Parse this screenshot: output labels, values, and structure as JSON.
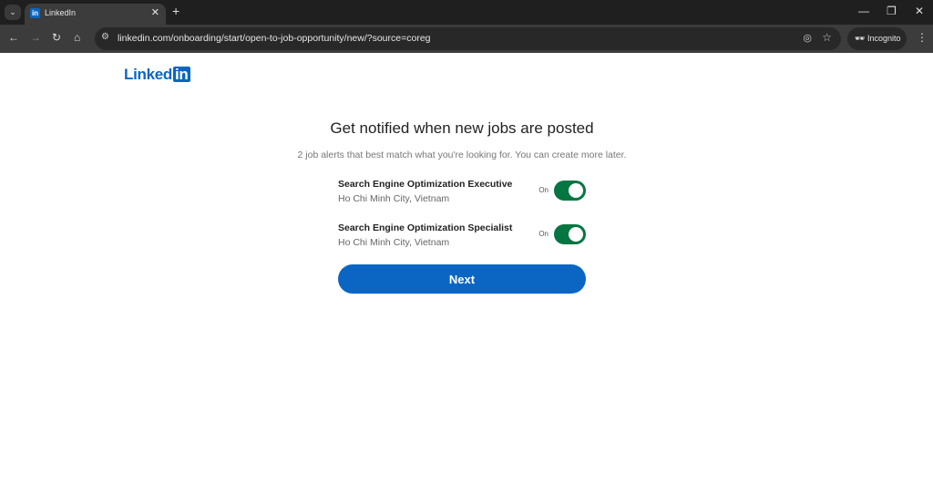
{
  "browser": {
    "tab_title": "LinkedIn",
    "favicon": "in",
    "url": "linkedin.com/onboarding/start/open-to-job-opportunity/new/?source=coreg",
    "incognito_label": "Incognito"
  },
  "logo": {
    "text": "Linked",
    "badge": "in",
    "color": "#0a66c2"
  },
  "main": {
    "title": "Get notified when new jobs are posted",
    "subtitle": "2 job alerts that best match what you're looking for. You can create more later.",
    "alerts": [
      {
        "title": "Search Engine Optimization Executive",
        "location": "Ho Chi Minh City, Vietnam",
        "toggle_label": "On",
        "enabled": true
      },
      {
        "title": "Search Engine Optimization Specialist",
        "location": "Ho Chi Minh City, Vietnam",
        "toggle_label": "On",
        "enabled": true
      }
    ],
    "next_label": "Next"
  },
  "colors": {
    "toggle_on": "#057642",
    "primary": "#0a66c2"
  }
}
